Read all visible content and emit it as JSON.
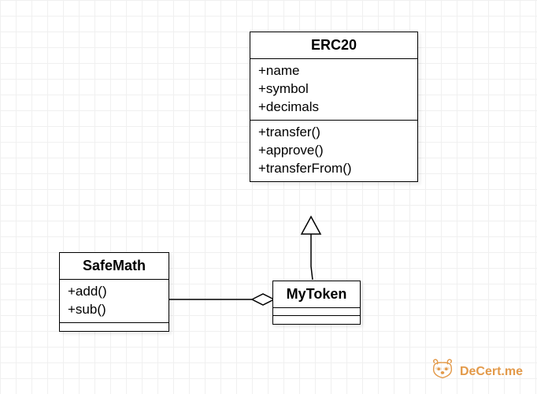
{
  "diagram": {
    "erc20": {
      "title": "ERC20",
      "attributes": [
        "+name",
        "+symbol",
        "+decimals"
      ],
      "methods": [
        "+transfer()",
        "+approve()",
        "+transferFrom()"
      ]
    },
    "safemath": {
      "title": "SafeMath",
      "methods": [
        "+add()",
        "+sub()"
      ]
    },
    "mytoken": {
      "title": "MyToken"
    },
    "relationships": [
      {
        "from": "MyToken",
        "to": "ERC20",
        "type": "generalization"
      },
      {
        "from": "MyToken",
        "to": "SafeMath",
        "type": "aggregation"
      }
    ]
  },
  "watermark": {
    "text": "DeCert.me",
    "icon": "raccoon-icon"
  }
}
